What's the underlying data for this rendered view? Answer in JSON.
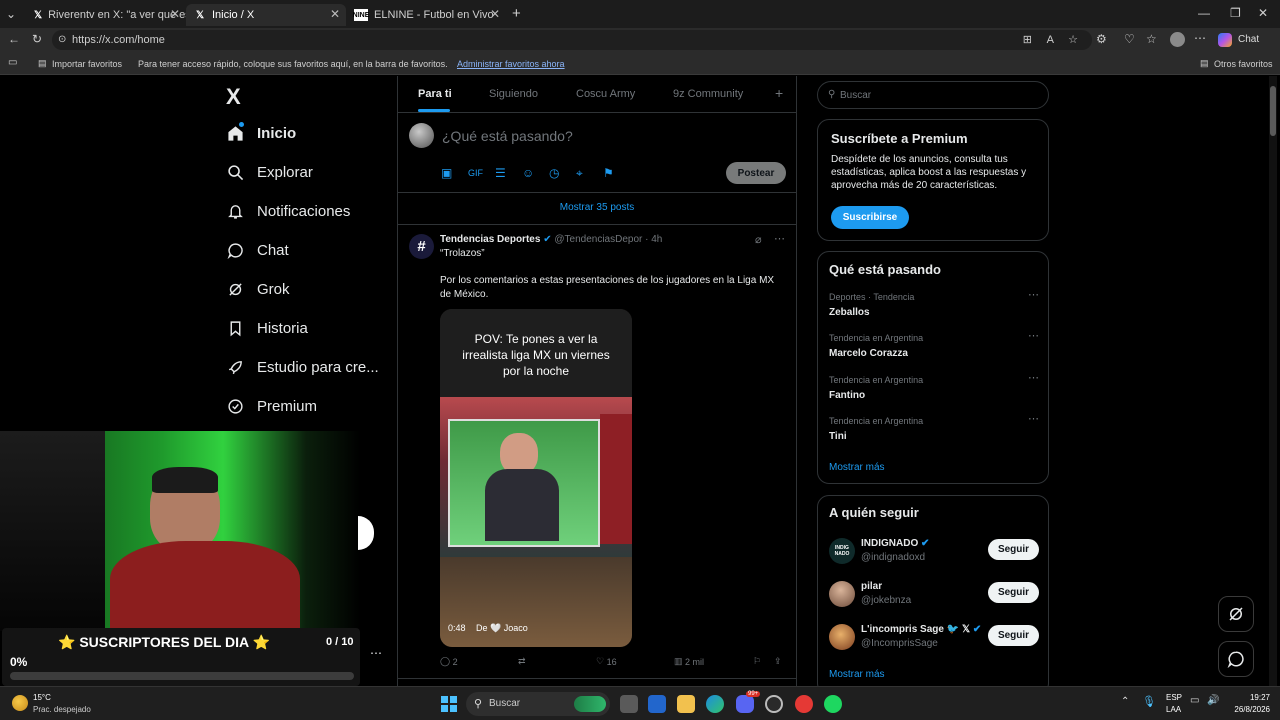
{
  "browser": {
    "tabs": [
      {
        "title": "Riverentv en X: \"a ver que es de la",
        "favicon": "x-logo"
      },
      {
        "title": "Inicio / X",
        "favicon": "x-logo"
      },
      {
        "title": "ELNINE - Futbol en Vivo",
        "favicon": "nine-logo"
      }
    ],
    "url": "https://x.com/home",
    "chat_label": "Chat",
    "favorites": {
      "import": "Importar favoritos",
      "hint": "Para tener acceso rápido, coloque sus favoritos aquí, en la barra de favoritos.",
      "manage_link": "Administrar favoritos ahora",
      "others": "Otros favoritos"
    }
  },
  "sidebar": {
    "logo": "X",
    "items": [
      {
        "label": "Inicio",
        "icon": "home-icon"
      },
      {
        "label": "Explorar",
        "icon": "search-icon"
      },
      {
        "label": "Notificaciones",
        "icon": "bell-icon"
      },
      {
        "label": "Chat",
        "icon": "chat-icon"
      },
      {
        "label": "Grok",
        "icon": "grok-icon"
      },
      {
        "label": "Historia",
        "icon": "bookmark-icon"
      },
      {
        "label": "Estudio para cre...",
        "icon": "rocket-icon"
      },
      {
        "label": "Premium",
        "icon": "verified-icon"
      }
    ]
  },
  "feed": {
    "tabs": [
      "Para ti",
      "Siguiendo",
      "Coscu Army",
      "9z Community"
    ],
    "add_tab": "+",
    "composer_placeholder": "¿Qué está pasando?",
    "post_button": "Postear",
    "show_more": "Mostrar 35 posts",
    "tweet": {
      "name": "Tendencias Deportes",
      "handle": "@TendenciasDepor",
      "time": "· 4h",
      "line1": "“Trolazos”",
      "line2": "Por los comentarios a estas presentaciones de los jugadores en la Liga MX de México.",
      "video_caption": "POV: Te pones a ver la irrealista liga MX un viernes por la noche",
      "video_duration": "0:48",
      "video_overlay": "De 🤍 Joaco",
      "replies": "2",
      "likes": "16",
      "views": "2 mil"
    }
  },
  "right": {
    "search_placeholder": "Buscar",
    "premium": {
      "title": "Suscríbete a Premium",
      "body": "Despídete de los anuncios, consulta tus estadísticas, aplica boost a las respuestas y aprovecha más de 20 características.",
      "button": "Suscribirse"
    },
    "trends": {
      "title": "Qué está pasando",
      "items": [
        {
          "context": "Deportes · Tendencia",
          "name": "Zeballos"
        },
        {
          "context": "Tendencia en Argentina",
          "name": "Marcelo Corazza"
        },
        {
          "context": "Tendencia en Argentina",
          "name": "Fantino"
        },
        {
          "context": "Tendencia en Argentina",
          "name": "Tini"
        }
      ],
      "more": "Mostrar más"
    },
    "follow": {
      "title": "A quién seguir",
      "items": [
        {
          "name": "INDIGNADO",
          "handle": "@indignadoxd",
          "button": "Seguir"
        },
        {
          "name": "pilar",
          "handle": "@jokebnza",
          "button": "Seguir"
        },
        {
          "name": "L'incompris Sage 🐦 𝕏",
          "handle": "@IncomprisSage",
          "button": "Seguir"
        }
      ],
      "more": "Mostrar más"
    }
  },
  "overlay": {
    "title": "⭐ SUSCRIPTORES DEL DIA ⭐",
    "count": "0 / 10",
    "percent": "0%",
    "progress": 0
  },
  "taskbar": {
    "temp": "15°C",
    "weather": "Prac. despejado",
    "search": "Buscar",
    "lang1": "ESP",
    "lang2": "LAA",
    "time": "19:27",
    "date": "26/8/2026",
    "badge": "99+"
  },
  "colors": {
    "accent": "#1d9bf0",
    "bg": "#000000",
    "border": "#2f3336",
    "muted": "#71767b",
    "webcam_green": "#29c93a"
  }
}
